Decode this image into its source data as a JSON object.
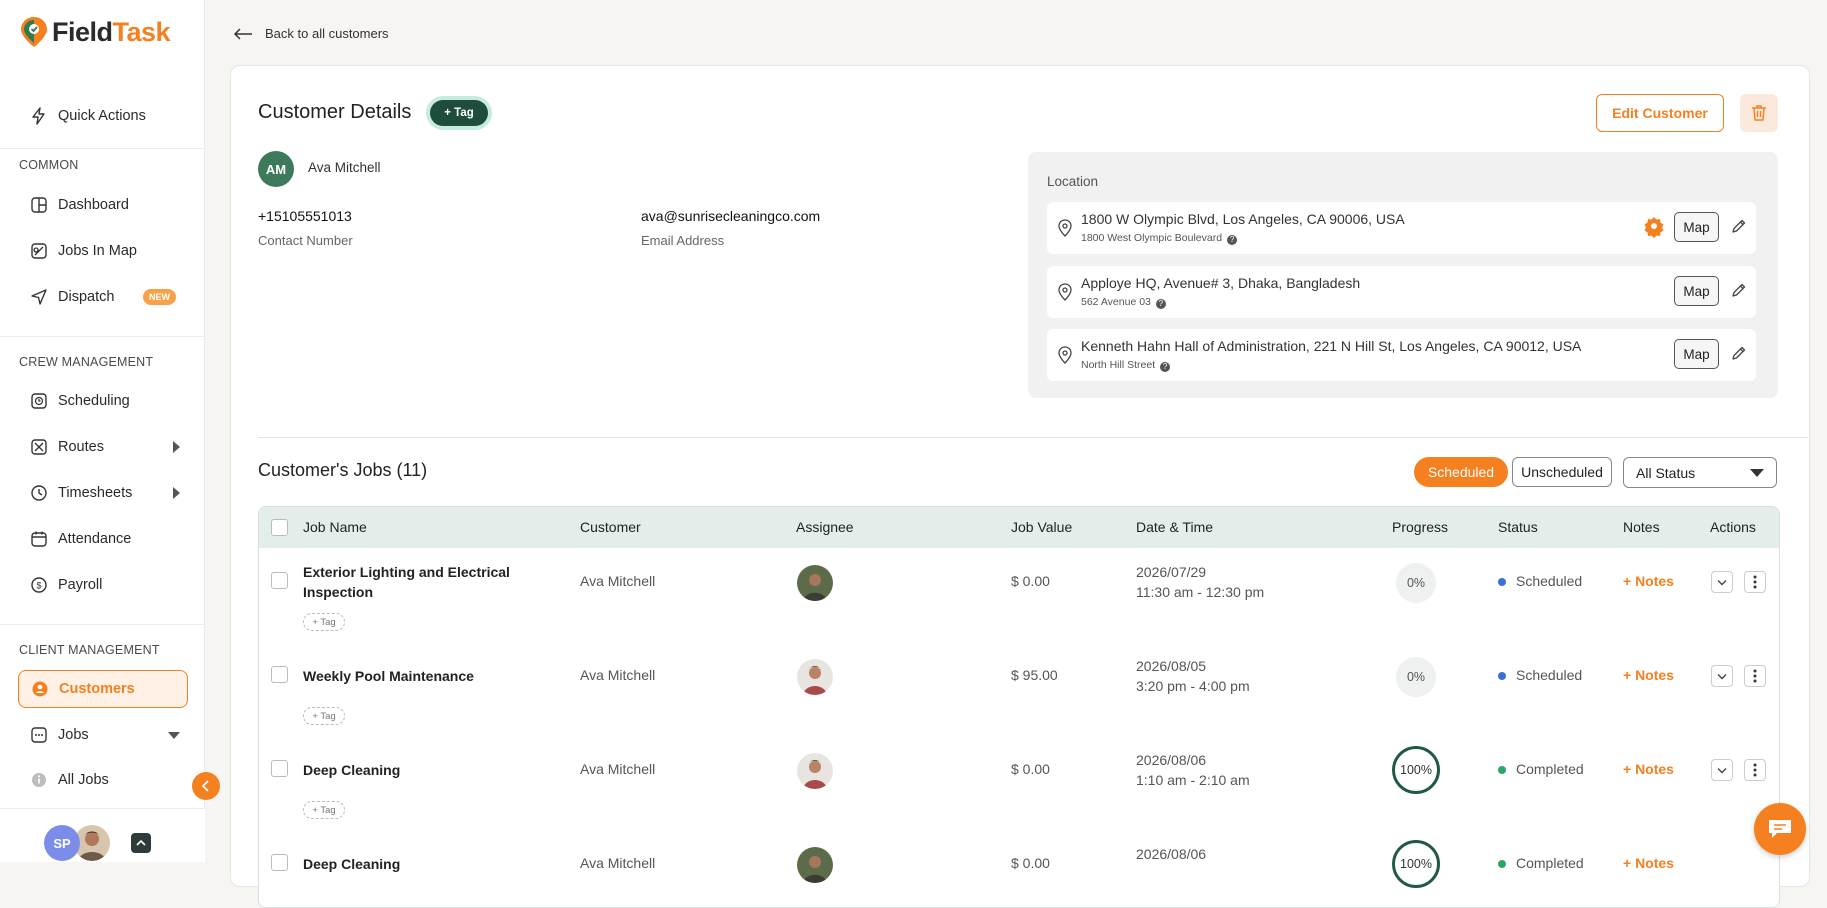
{
  "brand": {
    "name_dark": "Field",
    "name_accent": "Task"
  },
  "sidebar": {
    "quick_actions": "Quick Actions",
    "section_common": "COMMON",
    "dashboard": "Dashboard",
    "jobs_in_map": "Jobs In Map",
    "dispatch": "Dispatch",
    "dispatch_badge": "NEW",
    "section_crew": "CREW MANAGEMENT",
    "scheduling": "Scheduling",
    "routes": "Routes",
    "timesheets": "Timesheets",
    "attendance": "Attendance",
    "payroll": "Payroll",
    "section_client": "CLIENT MANAGEMENT",
    "customers": "Customers",
    "jobs": "Jobs",
    "all_jobs": "All Jobs",
    "user_initials": "SP"
  },
  "back_link": "Back to all customers",
  "customer": {
    "section_title": "Customer Details",
    "tag_label": "+ Tag",
    "edit_label": "Edit Customer",
    "initials": "AM",
    "name": "Ava Mitchell",
    "phone": "+15105551013",
    "phone_label": "Contact Number",
    "email": "ava@sunrisecleaningco.com",
    "email_label": "Email Address"
  },
  "location": {
    "title": "Location",
    "map_label": "Map",
    "addresses": [
      {
        "line": "1800 W Olympic Blvd, Los Angeles, CA 90006, USA",
        "sub": "1800 West Olympic Boulevard",
        "primary": true
      },
      {
        "line": "Apploye HQ, Avenue# 3, Dhaka, Bangladesh",
        "sub": "562 Avenue 03",
        "primary": false
      },
      {
        "line": "Kenneth Hahn Hall of Administration, 221 N Hill St, Los Angeles, CA 90012, USA",
        "sub": "North Hill Street",
        "primary": false
      }
    ]
  },
  "jobs": {
    "title": "Customer's Jobs (11)",
    "filter_scheduled": "Scheduled",
    "filter_unscheduled": "Unscheduled",
    "status_select": "All Status",
    "columns": [
      "Job Name",
      "Customer",
      "Assignee",
      "Job Value",
      "Date & Time",
      "Progress",
      "Status",
      "Notes",
      "Actions"
    ],
    "tag_chip": "+ Tag",
    "notes_label": "+ Notes",
    "rows": [
      {
        "name": "Exterior Lighting and Electrical Inspection",
        "customer": "Ava Mitchell",
        "value": "$ 0.00",
        "date": "2026/07/29",
        "time": "11:30 am - 12:30 pm",
        "progress": "0%",
        "status": "Scheduled"
      },
      {
        "name": "Weekly Pool Maintenance",
        "customer": "Ava Mitchell",
        "value": "$ 95.00",
        "date": "2026/08/05",
        "time": "3:20 pm - 4:00 pm",
        "progress": "0%",
        "status": "Scheduled"
      },
      {
        "name": "Deep Cleaning",
        "customer": "Ava Mitchell",
        "value": "$ 0.00",
        "date": "2026/08/06",
        "time": "1:10 am - 2:10 am",
        "progress": "100%",
        "status": "Completed"
      },
      {
        "name": "Deep Cleaning",
        "customer": "Ava Mitchell",
        "value": "$ 0.00",
        "date": "2026/08/06",
        "time": "",
        "progress": "100%",
        "status": "Completed"
      }
    ]
  },
  "colors": {
    "accent": "#f4801f",
    "status_scheduled": "#3b6fd8",
    "status_completed": "#2aa667",
    "progress_done": "#23574a"
  }
}
